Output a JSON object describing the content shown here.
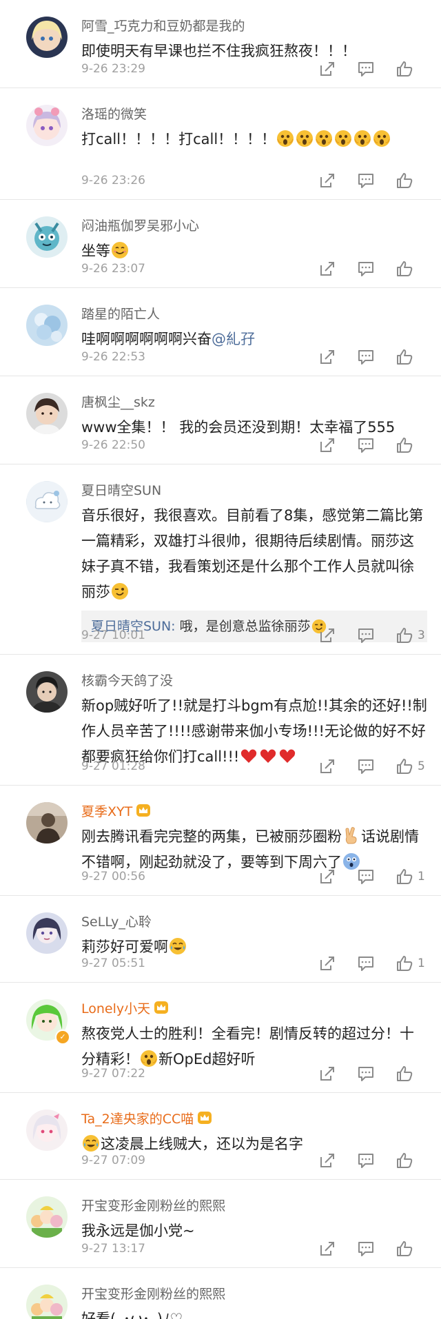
{
  "colors": {
    "username": "#666666",
    "vip_username": "#e86c1a",
    "mention": "#4e6d9a",
    "timestamp": "#a0a0a0",
    "divider": "#e6e6e6",
    "reply_bg": "#f2f2f2"
  },
  "comments": [
    {
      "username": "阿雪_巧克力和豆奶都是我的",
      "text": "即使明天有早课也拦不住我疯狂熬夜！！！",
      "time": "9-26 23:29",
      "likes": ""
    },
    {
      "username": "洛瑶的微笑",
      "text": "打call！！！！打call！！！！",
      "emoji": "scream-emoji",
      "emoji_count": 6,
      "time": "9-26 23:26",
      "likes": ""
    },
    {
      "username": "闷油瓶伽罗吴邪小心",
      "text": "坐等",
      "emoji": "smile-emoji",
      "time": "9-26 23:07",
      "likes": ""
    },
    {
      "username": "踏星的陌亡人",
      "text": "哇啊啊啊啊啊啊兴奋",
      "mention": "@糺孖",
      "time": "9-26 22:53",
      "likes": ""
    },
    {
      "username": "唐枫尘__skz",
      "text": "www全集！！ 我的会员还没到期！太幸福了555",
      "time": "9-26 22:50",
      "likes": ""
    },
    {
      "username": "夏日晴空SUN",
      "text": "音乐很好，我很喜欢。目前看了8集，感觉第二篇比第一篇精彩，双雄打斗很帅，很期待后续剧情。丽莎这妹子真不错，我看策划还是什么那个工作人员就叫徐丽莎",
      "emoji": "wink-emoji",
      "reply_name": "夏日晴空SUN:",
      "reply_text": " 哦，是创意总监徐丽莎",
      "time": "9-27 10:01",
      "likes": "3"
    },
    {
      "username": "核霸今天鸽了没",
      "text": "新op贼好听了!!就是打斗bgm有点尬!!其余的还好!!制作人员辛苦了!!!!感谢带来伽小专场!!!无论做的好不好都要疯狂给你们打call!!!",
      "emoji": "heart-emoji",
      "emoji_count": 3,
      "time": "9-27 01:28",
      "likes": "5"
    },
    {
      "username": "夏季XYT",
      "vip": true,
      "text": "刚去腾讯看完完整的两集，已被丽莎圈粉",
      "emoji": "victory-emoji",
      "text2": "话说剧情不错啊，刚起劲就没了，要等到下周六了",
      "emoji2": "astonished-emoji",
      "time": "9-27 00:56",
      "likes": "1"
    },
    {
      "username": "SeLLy_心聆",
      "text": "莉莎好可爱啊",
      "emoji": "laugh-cry-emoji",
      "time": "9-27 05:51",
      "likes": "1"
    },
    {
      "username": "Lonely小天",
      "vip": true,
      "verified": true,
      "text": "熬夜党人士的胜利！全看完！剧情反转的超过分！十分精彩！",
      "emoji": "scream-emoji",
      "text2": "新OpEd超好听",
      "time": "9-27 07:22",
      "likes": ""
    },
    {
      "username": "Ta_2達央家的CC喵",
      "vip": true,
      "text": "这凌晨上线贼大，还以为是名字",
      "emoji": "laugh-cry-emoji",
      "time": "9-27 07:09",
      "likes": ""
    },
    {
      "username": "开宝变形金刚粉丝的熙熙",
      "text": "我永远是伽小党~",
      "time": "9-27 13:17",
      "likes": ""
    },
    {
      "username": "开宝变形金刚粉丝的熙熙",
      "text": "好看(｡･ω･｡)ﾉ♡",
      "time": "",
      "likes": ""
    }
  ]
}
